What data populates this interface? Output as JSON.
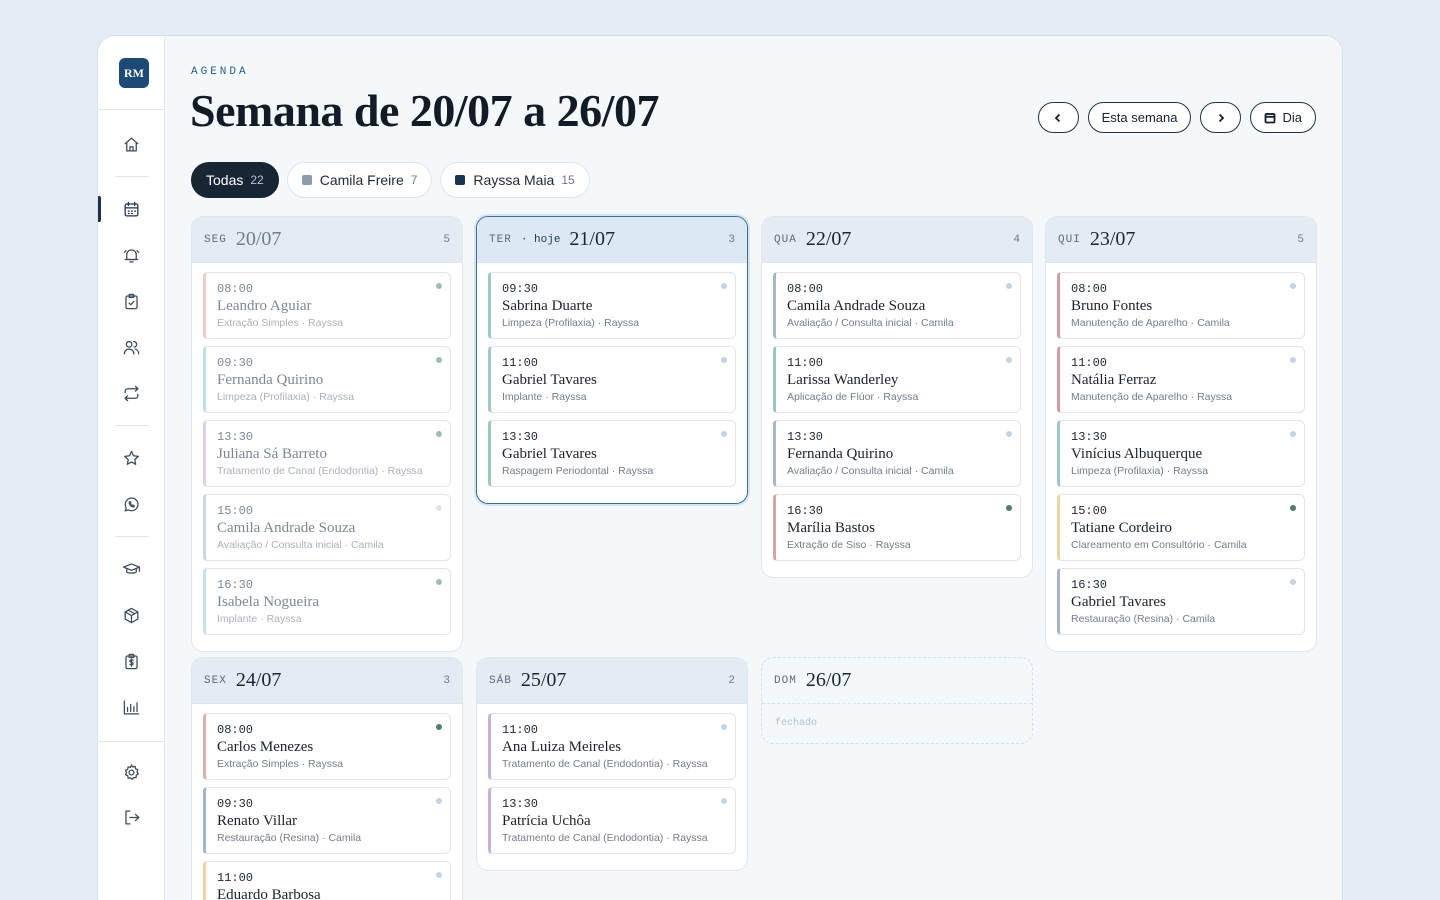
{
  "brand": {
    "initials": "RM"
  },
  "header": {
    "eyebrow": "AGENDA",
    "title": "Semana de 20/07 a 26/07"
  },
  "toolbar": {
    "prev_icon": "chevron-left-icon",
    "this_week": "Esta semana",
    "next_icon": "chevron-right-icon",
    "day_view": "Dia",
    "day_view_icon": "calendar-icon"
  },
  "filters": [
    {
      "label": "Todas",
      "count": "22",
      "active": true
    },
    {
      "label": "Camila Freire",
      "count": "7",
      "color": "#8d9aa8"
    },
    {
      "label": "Rayssa Maia",
      "count": "15",
      "color": "#1c3350"
    }
  ],
  "colors": {
    "status_done": "#5b8a78",
    "status_pending": "#c6d4e2",
    "status_past": "#a7b3bf",
    "procedures": {
      "extracao": "#d9b2ac",
      "limpeza": "#9ccac3",
      "canal": "#c5b3d8",
      "avaliacao": "#a8b8c9",
      "implante": "#a6c7cc",
      "raspagem": "#9dcab9",
      "aparelho": "#cf9fa3",
      "fluor": "#98c8c0",
      "clareamento": "#e8d6a2",
      "resina": "#a7b4c4",
      "siso": "#d3a6a6"
    }
  },
  "days": [
    {
      "dow": "SEG",
      "date": "20/07",
      "count": "5",
      "past": true,
      "appointments": [
        {
          "time": "08:00",
          "patient": "Leandro Aguiar",
          "procedure": "Extração Simples · Rayssa",
          "color": "#e8cfca",
          "status": "#9fbdb1"
        },
        {
          "time": "09:30",
          "patient": "Fernanda Quirino",
          "procedure": "Limpeza (Profilaxia) · Rayssa",
          "color": "#bfe0db",
          "status": "#9fbdb1"
        },
        {
          "time": "13:30",
          "patient": "Juliana Sá Barreto",
          "procedure": "Tratamento de Canal (Endodontia) · Rayssa",
          "color": "#ddd1e8",
          "status": "#9fbdb1"
        },
        {
          "time": "15:00",
          "patient": "Camila Andrade Souza",
          "procedure": "Avaliação / Consulta inicial · Camila",
          "color": "#cbd6e1",
          "status": "#dbe4ec"
        },
        {
          "time": "16:30",
          "patient": "Isabela Nogueira",
          "procedure": "Implante · Rayssa",
          "color": "#c7dfe2",
          "status": "#9fbdb1"
        }
      ]
    },
    {
      "dow": "TER",
      "today_label": "· hoje",
      "date": "21/07",
      "count": "3",
      "today": true,
      "appointments": [
        {
          "time": "09:30",
          "patient": "Sabrina Duarte",
          "procedure": "Limpeza (Profilaxia) · Rayssa",
          "color": "#9ccac3",
          "status": "#c6d4e2"
        },
        {
          "time": "11:00",
          "patient": "Gabriel Tavares",
          "procedure": "Implante · Rayssa",
          "color": "#a6c7cc",
          "status": "#c6d4e2"
        },
        {
          "time": "13:30",
          "patient": "Gabriel Tavares",
          "procedure": "Raspagem Periodontal · Rayssa",
          "color": "#9dcab9",
          "status": "#c6d4e2"
        }
      ]
    },
    {
      "dow": "QUA",
      "date": "22/07",
      "count": "4",
      "appointments": [
        {
          "time": "08:00",
          "patient": "Camila Andrade Souza",
          "procedure": "Avaliação / Consulta inicial · Camila",
          "color": "#a8b8c9",
          "status": "#c6d4e2"
        },
        {
          "time": "11:00",
          "patient": "Larissa Wanderley",
          "procedure": "Aplicação de Flúor · Rayssa",
          "color": "#98c8c0",
          "status": "#c6d4e2"
        },
        {
          "time": "13:30",
          "patient": "Fernanda Quirino",
          "procedure": "Avaliação / Consulta inicial · Camila",
          "color": "#a8b8c9",
          "status": "#c6d4e2"
        },
        {
          "time": "16:30",
          "patient": "Marília Bastos",
          "procedure": "Extração de Siso · Rayssa",
          "color": "#d3a6a6",
          "status": "#4f7d6a"
        }
      ]
    },
    {
      "dow": "QUI",
      "date": "23/07",
      "count": "5",
      "appointments": [
        {
          "time": "08:00",
          "patient": "Bruno Fontes",
          "procedure": "Manutenção de Aparelho · Camila",
          "color": "#cf9fa3",
          "status": "#c6d4e2"
        },
        {
          "time": "11:00",
          "patient": "Natália Ferraz",
          "procedure": "Manutenção de Aparelho · Rayssa",
          "color": "#cf9fa3",
          "status": "#c6d4e2"
        },
        {
          "time": "13:30",
          "patient": "Vinícius Albuquerque",
          "procedure": "Limpeza (Profilaxia) · Rayssa",
          "color": "#9ccac3",
          "status": "#c6d4e2"
        },
        {
          "time": "15:00",
          "patient": "Tatiane Cordeiro",
          "procedure": "Clareamento em Consultório · Camila",
          "color": "#e8d6a2",
          "status": "#4f7d6a"
        },
        {
          "time": "16:30",
          "patient": "Gabriel Tavares",
          "procedure": "Restauração (Resina) · Camila",
          "color": "#a7b4c4",
          "status": "#c6d4e2"
        }
      ]
    },
    {
      "dow": "SEX",
      "date": "24/07",
      "count": "3",
      "appointments": [
        {
          "time": "08:00",
          "patient": "Carlos Menezes",
          "procedure": "Extração Simples · Rayssa",
          "color": "#d9b2ac",
          "status": "#4f7d6a"
        },
        {
          "time": "09:30",
          "patient": "Renato Villar",
          "procedure": "Restauração (Resina) · Camila",
          "color": "#a7b4c4",
          "status": "#c6d4e2"
        },
        {
          "time": "11:00",
          "patient": "Eduardo Barbosa",
          "procedure": "",
          "color": "#e8d6a2",
          "status": "#c6d4e2"
        }
      ]
    },
    {
      "dow": "SÁB",
      "date": "25/07",
      "count": "2",
      "appointments": [
        {
          "time": "11:00",
          "patient": "Ana Luiza Meireles",
          "procedure": "Tratamento de Canal (Endodontia) · Rayssa",
          "color": "#c5b3d8",
          "status": "#c6d4e2"
        },
        {
          "time": "13:30",
          "patient": "Patrícia Uchôa",
          "procedure": "Tratamento de Canal (Endodontia) · Rayssa",
          "color": "#c5b3d8",
          "status": "#c6d4e2"
        }
      ]
    },
    {
      "dow": "DOM",
      "date": "26/07",
      "count": "",
      "closed": true,
      "closed_label": "fechado",
      "appointments": []
    }
  ],
  "nav": [
    {
      "name": "home-icon"
    },
    {
      "name": "calendar-icon",
      "active": true
    },
    {
      "name": "bell-icon"
    },
    {
      "name": "clipboard-icon"
    },
    {
      "name": "users-icon"
    },
    {
      "name": "repeat-icon"
    },
    {
      "name": "star-icon"
    },
    {
      "name": "whatsapp-icon"
    },
    {
      "name": "graduation-cap-icon"
    },
    {
      "name": "box-icon"
    },
    {
      "name": "dollar-clipboard-icon"
    },
    {
      "name": "bar-chart-icon"
    },
    {
      "name": "gear-icon"
    },
    {
      "name": "logout-icon"
    }
  ]
}
